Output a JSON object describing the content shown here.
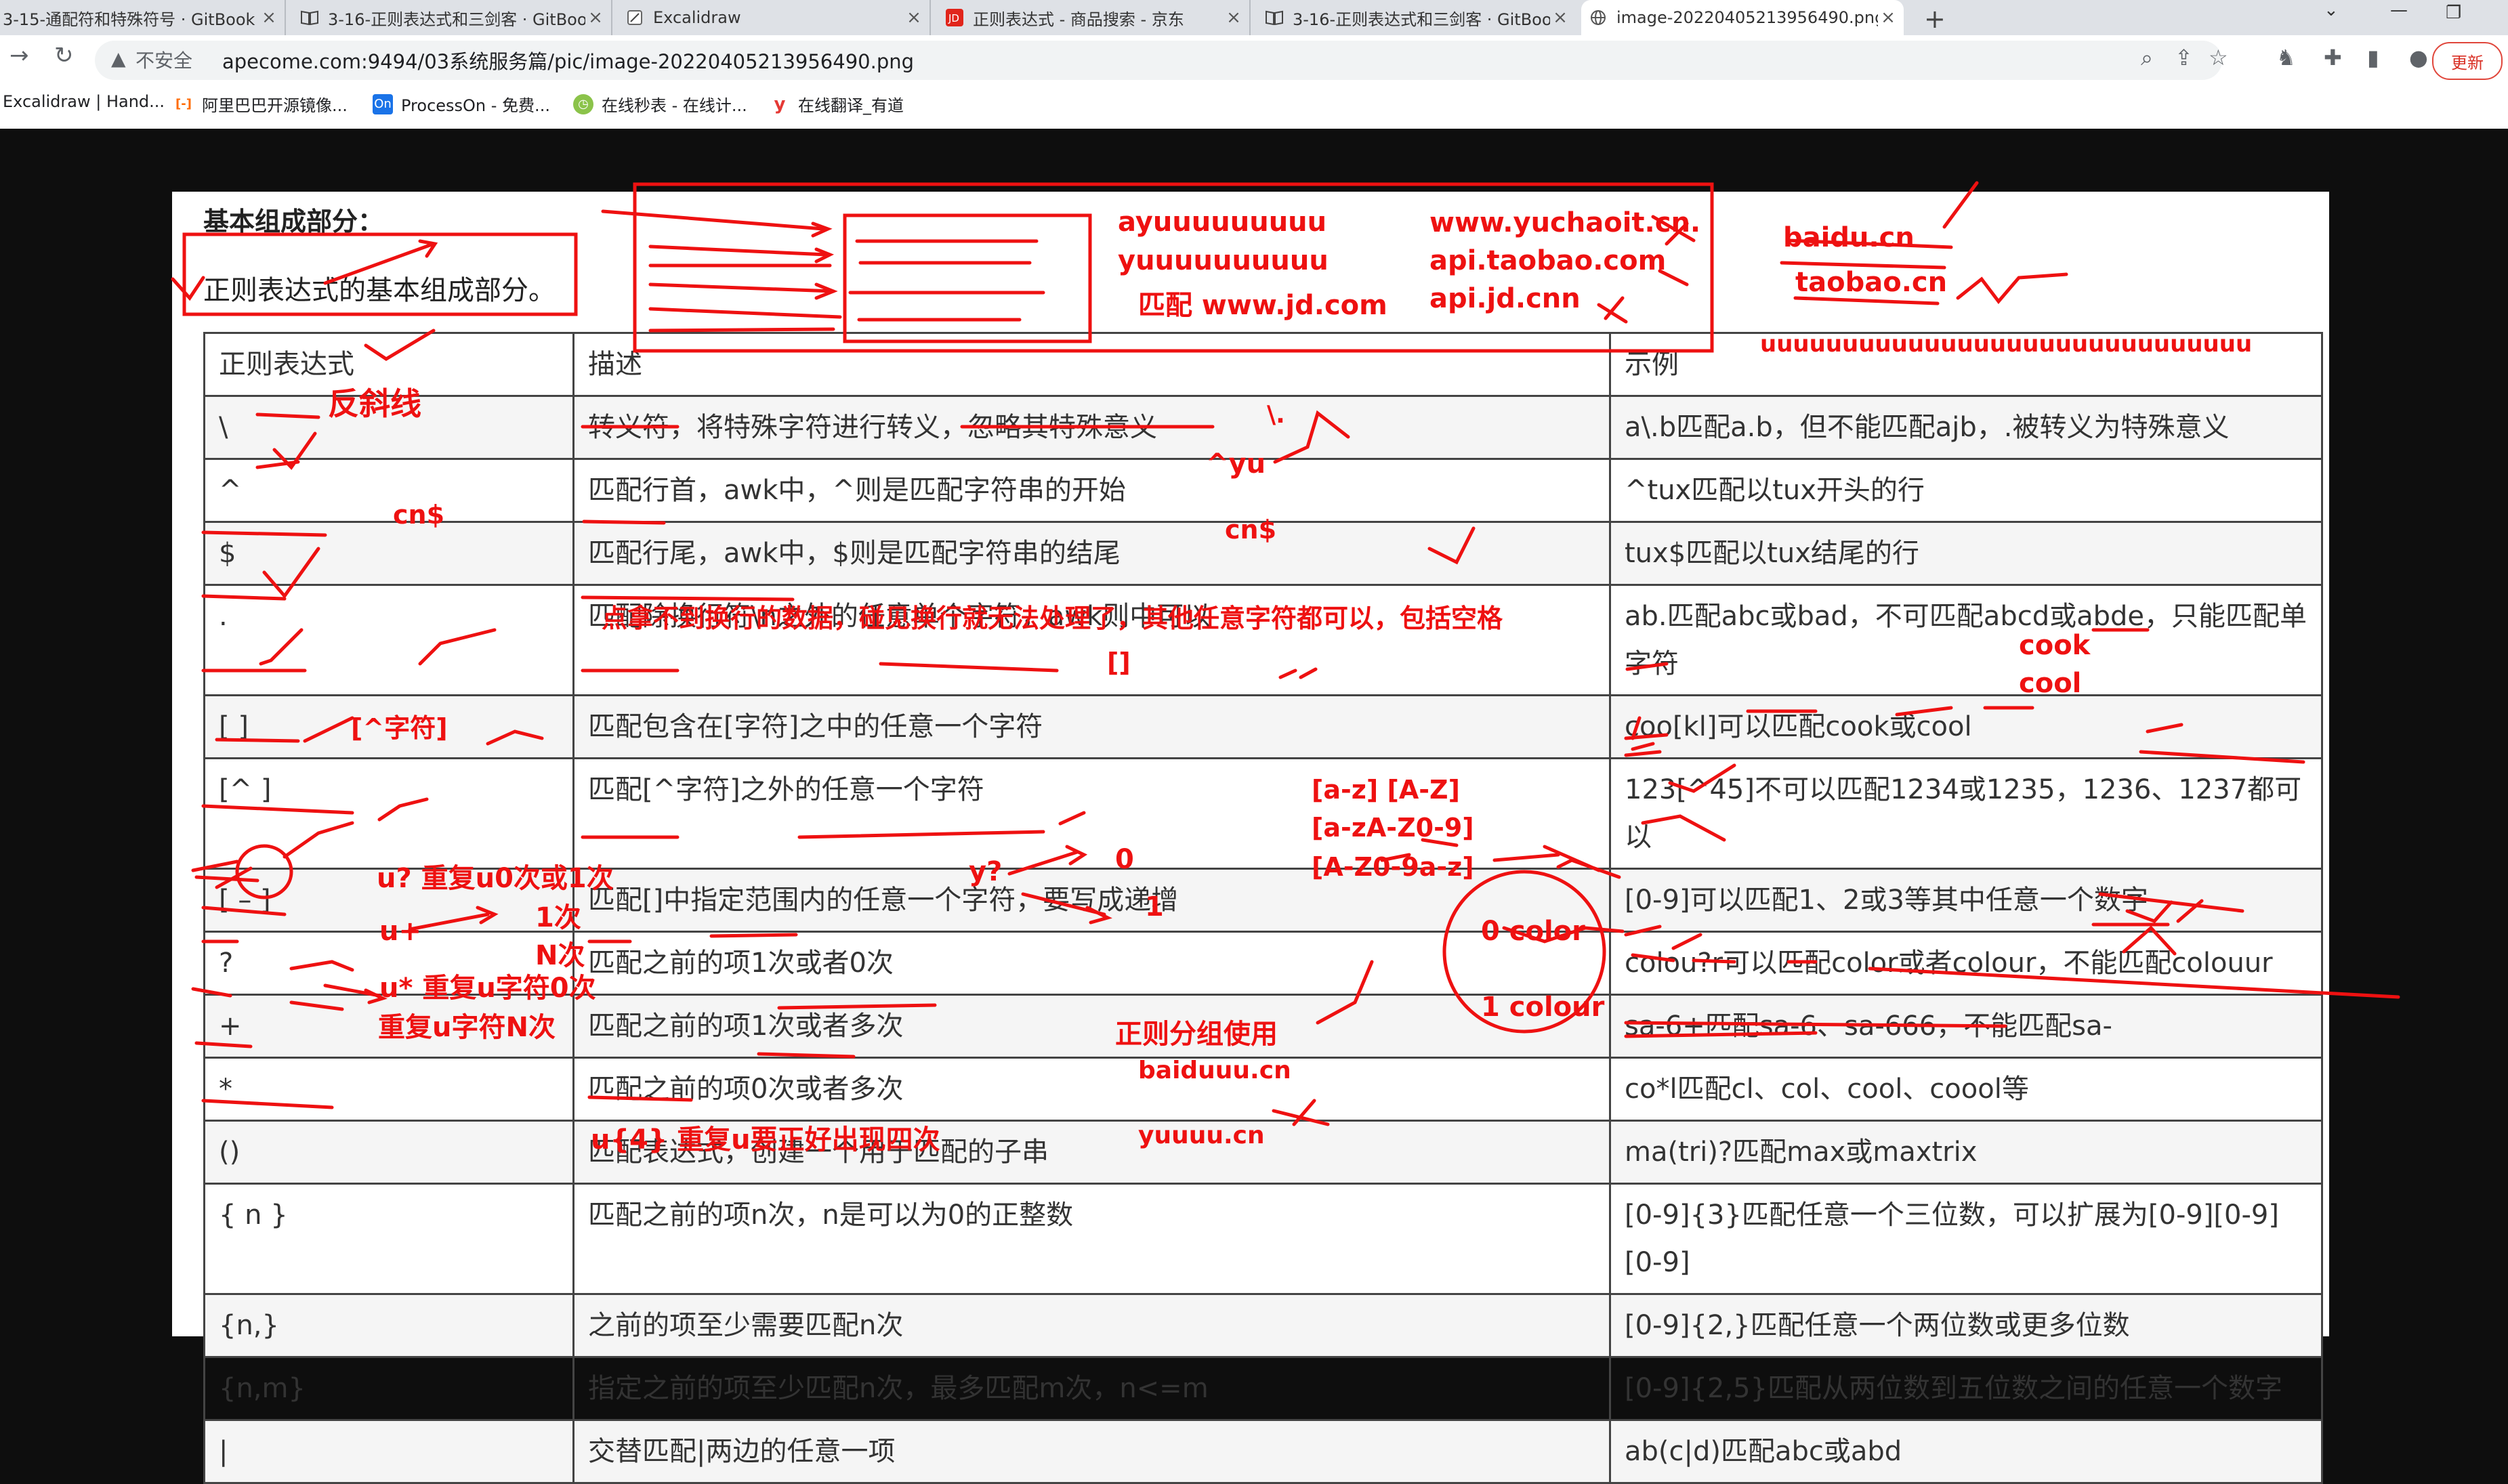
{
  "browser": {
    "tabs": [
      {
        "title": "3-15-通配符和特殊符号 · GitBook",
        "icon": "book-icon"
      },
      {
        "title": "3-16-正则表达式和三剑客 · GitBook",
        "icon": "book-icon"
      },
      {
        "title": "Excalidraw",
        "icon": "excalidraw-icon"
      },
      {
        "title": "正则表达式 - 商品搜索 - 京东",
        "icon": "jd-icon"
      },
      {
        "title": "3-16-正则表达式和三剑客 · GitBook",
        "icon": "book-icon"
      },
      {
        "title": "image-20220405213956490.png",
        "icon": "globe-icon"
      }
    ],
    "security_label": "不安全",
    "url": "apecome.com:9494/03系统服务篇/pic/image-20220405213956490.png",
    "update_button": "更新",
    "bookmarks": [
      {
        "label": "Excalidraw | Hand...",
        "icon": "excalidraw-icon"
      },
      {
        "label": "阿里巴巴开源镜像...",
        "icon": "aliyun-icon"
      },
      {
        "label": "ProcessOn - 免费...",
        "icon": "processon-icon"
      },
      {
        "label": "在线秒表 - 在线计...",
        "icon": "stopwatch-icon"
      },
      {
        "label": "在线翻译_有道",
        "icon": "youdao-icon"
      }
    ],
    "accent": "#1a73e8"
  },
  "doc": {
    "heading": "基本组成部分：",
    "description": "正则表达式的基本组成部分。",
    "columns": [
      "正则表达式",
      "描述",
      "示例"
    ],
    "rows": [
      {
        "expr": "\\",
        "desc": "转义符，将特殊字符进行转义，忽略其特殊意义",
        "example": "a\\.b匹配a.b，但不能匹配ajb，.被转义为特殊意义"
      },
      {
        "expr": "^",
        "desc": "匹配行首，awk中，^则是匹配字符串的开始",
        "example": "^tux匹配以tux开头的行"
      },
      {
        "expr": "$",
        "desc": "匹配行尾，awk中，$则是匹配字符串的结尾",
        "example": "tux$匹配以tux结尾的行"
      },
      {
        "expr": ".",
        "desc": "匹配除换行符\\n之外的任意单个字符，awk则中可以",
        "example": "ab.匹配abc或bad，不可匹配abcd或abde，只能匹配单字符"
      },
      {
        "expr": "[ ]",
        "desc": "匹配包含在[字符]之中的任意一个字符",
        "example": "coo[kl]可以匹配cook或cool"
      },
      {
        "expr": "[^ ]",
        "desc": "匹配[^字符]之外的任意一个字符",
        "example": "123[^45]不可以匹配1234或1235，1236、1237都可以"
      },
      {
        "expr": "[ – ]",
        "desc": "匹配[]中指定范围内的任意一个字符，要写成递增",
        "example": "[0-9]可以匹配1、2或3等其中任意一个数字"
      },
      {
        "expr": "?",
        "desc": "匹配之前的项1次或者0次",
        "example": "colou?r可以匹配color或者colour，不能匹配colouur"
      },
      {
        "expr": "+",
        "desc": "匹配之前的项1次或者多次",
        "example": "sa-6+匹配sa-6、sa-666，不能匹配sa-"
      },
      {
        "expr": "*",
        "desc": "匹配之前的项0次或者多次",
        "example": "co*l匹配cl、col、cool、coool等"
      },
      {
        "expr": "()",
        "desc": "匹配表达式，创建一个用于匹配的子串",
        "example": "ma(tri)?匹配max或maxtrix"
      },
      {
        "expr": "{ n }",
        "desc": "匹配之前的项n次，n是可以为0的正整数",
        "example": "[0-9]{3}匹配任意一个三位数，可以扩展为[0-9][0-9][0-9]"
      },
      {
        "expr": "{n,}",
        "desc": "之前的项至少需要匹配n次",
        "example": "[0-9]{2,}匹配任意一个两位数或更多位数"
      },
      {
        "expr": "{n,m}",
        "desc": "指定之前的项至少匹配n次，最多匹配m次，n<=m",
        "example": "[0-9]{2,5}匹配从两位数到五位数之间的任意一个数字"
      },
      {
        "expr": "|",
        "desc": "交替匹配|两边的任意一项",
        "example": "ab(c|d)匹配abc或abd"
      }
    ]
  },
  "annotations": {
    "color": "#ee1111",
    "items": [
      "ayuuuuuuuuu",
      "yuuuuuuuuuu",
      "匹配 www.jd.com",
      "www.yuchaoit.cn.",
      "api.taobao.com",
      "api.jd.cnn",
      "baidu.cn",
      "taobao.cn",
      "uuuuuuuuuuuuuuuuuuuuuuuuuuuuuu",
      "反斜线",
      "\\.",
      "^yu",
      "cn$",
      "cn$",
      "点拿不到换行的数据，碰见换行就无法处理了，其他任意字符都可以，包括空格",
      "cook",
      "cool",
      "[]",
      "[^字符]",
      "[a-z]  [A-Z]",
      "[a-zA-Z0-9]",
      "[A-Z0-9a-z]",
      "u?  重复u0次或1次",
      "y?",
      "0",
      "1",
      "u+",
      "1次",
      "N次",
      "u*  重复u字符0次",
      "重复u字符N次",
      "0  color",
      "1  colour",
      "正则分组使用",
      "baiduuu.cn",
      "yuuuu.cn",
      "u{4}  重复u要正好出现四次"
    ]
  }
}
